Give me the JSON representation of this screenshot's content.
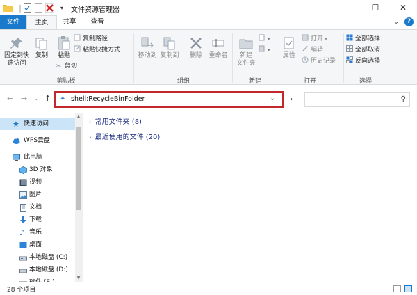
{
  "window": {
    "title": "文件资源管理器",
    "minimize": "—",
    "maximize": "☐",
    "close": "✕"
  },
  "tabs": [
    {
      "label": "文件"
    },
    {
      "label": "主页"
    },
    {
      "label": "共享"
    },
    {
      "label": "查看"
    }
  ],
  "ribbon": {
    "clipboard": {
      "group_label": "剪贴板",
      "pin_quick_access": "固定到快\n速访问",
      "pin_line1": "固定到快",
      "pin_line2": "速访问",
      "copy": "复制",
      "paste": "粘贴",
      "copy_path": "复制路径",
      "paste_shortcut": "粘贴快捷方式",
      "cut": "剪切"
    },
    "organize": {
      "group_label": "组织",
      "move_to": "移动到",
      "copy_to": "复制到",
      "delete": "删除",
      "rename": "重命名"
    },
    "new": {
      "group_label": "新建",
      "new_folder_line1": "新建",
      "new_folder_line2": "文件夹"
    },
    "open": {
      "group_label": "打开",
      "properties": "属性",
      "open": "打开",
      "edit": "编辑",
      "history": "历史记录"
    },
    "select": {
      "group_label": "选择",
      "select_all": "全部选择",
      "select_none": "全部取消",
      "invert": "反向选择"
    }
  },
  "address": {
    "value": "shell:RecycleBinFolder"
  },
  "nav_pane": {
    "items": [
      {
        "label": "快速访问",
        "icon": "star-icon"
      },
      {
        "label": "WPS云盘",
        "icon": "cloud-icon"
      },
      {
        "label": "此电脑",
        "icon": "computer-icon"
      },
      {
        "label": "3D 对象",
        "icon": "cube-icon"
      },
      {
        "label": "视频",
        "icon": "video-icon"
      },
      {
        "label": "图片",
        "icon": "picture-icon"
      },
      {
        "label": "文档",
        "icon": "document-icon"
      },
      {
        "label": "下载",
        "icon": "download-icon"
      },
      {
        "label": "音乐",
        "icon": "music-icon"
      },
      {
        "label": "桌面",
        "icon": "desktop-icon"
      },
      {
        "label": "本地磁盘 (C:)",
        "icon": "drive-icon"
      },
      {
        "label": "本地磁盘 (D:)",
        "icon": "drive-icon"
      },
      {
        "label": "软件 (E:)",
        "icon": "drive-icon"
      }
    ]
  },
  "content": {
    "sections": [
      {
        "label": "常用文件夹 (8)"
      },
      {
        "label": "最近使用的文件 (20)"
      }
    ]
  },
  "status": {
    "item_count": "28 个项目"
  },
  "colors": {
    "accent": "#1979ca",
    "highlight_border": "#c1272d",
    "selected_bg": "#cce4f7"
  }
}
